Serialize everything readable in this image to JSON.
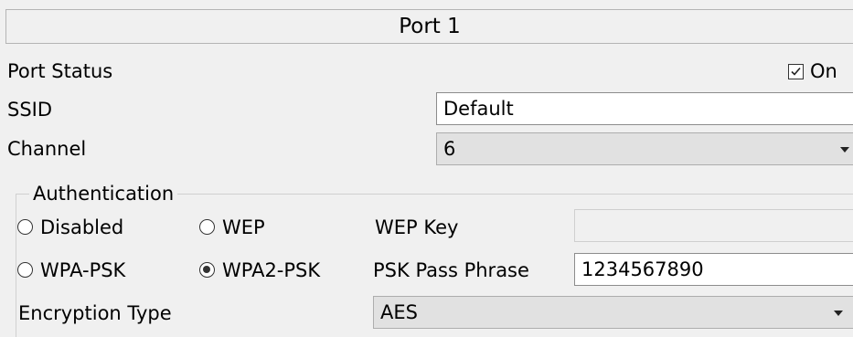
{
  "port": {
    "title": "Port 1",
    "status_label": "Port Status",
    "status_checkbox_label": "On",
    "status_checked": true,
    "ssid_label": "SSID",
    "ssid_value": "Default",
    "channel_label": "Channel",
    "channel_value": "6"
  },
  "authentication": {
    "group_label": "Authentication",
    "options": {
      "disabled": "Disabled",
      "wep": "WEP",
      "wpa_psk": "WPA-PSK",
      "wpa2_psk": "WPA2-PSK"
    },
    "selected": "WPA2-PSK",
    "wep_key_label": "WEP Key",
    "wep_key_value": "",
    "psk_label": "PSK Pass Phrase",
    "psk_value": "1234567890",
    "encryption_label": "Encryption Type",
    "encryption_value": "AES"
  }
}
